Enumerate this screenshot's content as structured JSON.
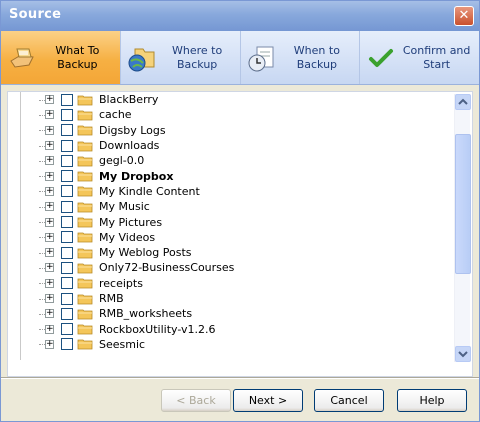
{
  "window": {
    "title": "Source"
  },
  "steps": [
    {
      "label": "What To Backup",
      "active": true
    },
    {
      "label": "Where to Backup",
      "active": false
    },
    {
      "label": "When to Backup",
      "active": false
    },
    {
      "label": "Confirm and Start",
      "active": false
    }
  ],
  "tree": {
    "items": [
      {
        "label": "BlackBerry",
        "bold": false
      },
      {
        "label": "cache",
        "bold": false
      },
      {
        "label": "Digsby Logs",
        "bold": false
      },
      {
        "label": "Downloads",
        "bold": false
      },
      {
        "label": "gegl-0.0",
        "bold": false
      },
      {
        "label": "My Dropbox",
        "bold": true
      },
      {
        "label": "My Kindle Content",
        "bold": false
      },
      {
        "label": "My Music",
        "bold": false
      },
      {
        "label": "My Pictures",
        "bold": false
      },
      {
        "label": "My Videos",
        "bold": false
      },
      {
        "label": "My Weblog Posts",
        "bold": false
      },
      {
        "label": "Only72-BusinessCourses",
        "bold": false
      },
      {
        "label": "receipts",
        "bold": false
      },
      {
        "label": "RMB",
        "bold": false
      },
      {
        "label": "RMB_worksheets",
        "bold": false
      },
      {
        "label": "RockboxUtility-v1.2.6",
        "bold": false
      },
      {
        "label": "Seesmic",
        "bold": false
      }
    ]
  },
  "buttons": {
    "back": "< Back",
    "next": "Next >",
    "cancel": "Cancel",
    "help": "Help"
  }
}
